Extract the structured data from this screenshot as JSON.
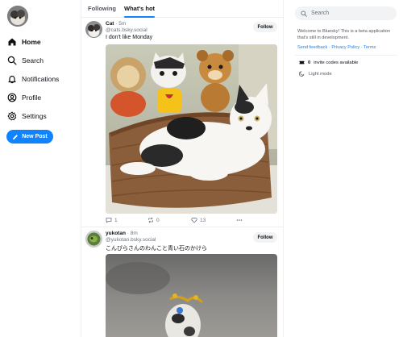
{
  "nav": {
    "items": [
      {
        "label": "Home",
        "icon": "home-icon"
      },
      {
        "label": "Search",
        "icon": "search-icon"
      },
      {
        "label": "Notifications",
        "icon": "bell-icon"
      },
      {
        "label": "Profile",
        "icon": "profile-icon"
      },
      {
        "label": "Settings",
        "icon": "gear-icon"
      }
    ],
    "new_post_label": "New Post"
  },
  "tabs": [
    {
      "label": "Following",
      "active": false
    },
    {
      "label": "What's hot",
      "active": true
    }
  ],
  "posts": [
    {
      "name": "Cat",
      "time": "· 5m",
      "handle": "@cats.bsky.social",
      "text": "I don't like Monday",
      "follow_label": "Follow",
      "reply_count": "1",
      "repost_count": "0",
      "like_count": "13"
    },
    {
      "name": "yukotan",
      "time": "· 8m",
      "handle": "@yukotan.bsky.social",
      "text": "こんぴらさんのわんこと青い石のかけら",
      "follow_label": "Follow"
    }
  ],
  "right": {
    "search_placeholder": "Search",
    "welcome_text": "Welcome to Bluesky! This is a beta application that's still in development.",
    "links": [
      "Send feedback",
      "Privacy Policy",
      "Terms"
    ],
    "link_separator": "·",
    "invite_count": "0",
    "invite_text": "invite codes available",
    "light_mode_label": "Light mode"
  },
  "colors": {
    "accent": "#1083fe",
    "muted_text": "#6b7380",
    "border": "#eceff3",
    "button_bg": "#f1f3f5"
  }
}
